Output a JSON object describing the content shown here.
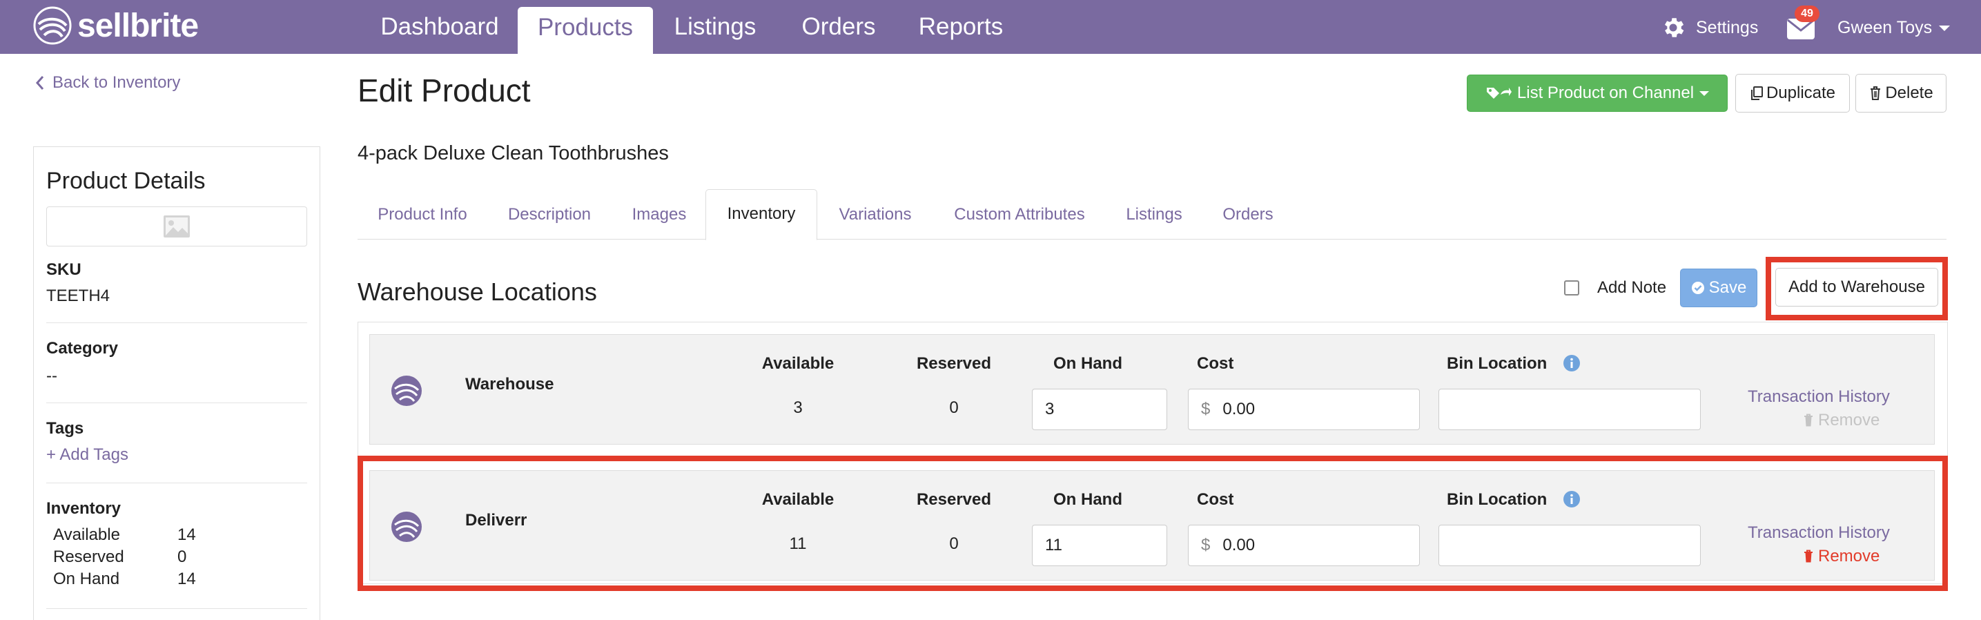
{
  "app": {
    "logo_text": "sellbrite"
  },
  "nav": {
    "items": [
      {
        "label": "Dashboard",
        "active": false
      },
      {
        "label": "Products",
        "active": true
      },
      {
        "label": "Listings",
        "active": false
      },
      {
        "label": "Orders",
        "active": false
      },
      {
        "label": "Reports",
        "active": false
      }
    ],
    "settings_label": "Settings",
    "mail_badge": "49",
    "account_label": "Gween Toys"
  },
  "sidebar": {
    "back_link": "Back to Inventory",
    "title": "Product Details",
    "sku_label": "SKU",
    "sku_value": "TEETH4",
    "category_label": "Category",
    "category_value": "--",
    "tags_label": "Tags",
    "add_tags": "+ Add Tags",
    "inventory_label": "Inventory",
    "inventory": [
      {
        "label": "Available",
        "value": "14"
      },
      {
        "label": "Reserved",
        "value": "0"
      },
      {
        "label": "On Hand",
        "value": "14"
      }
    ]
  },
  "header": {
    "title": "Edit Product",
    "product_name": "4-pack Deluxe Clean Toothbrushes",
    "list_button": "List Product on Channel",
    "duplicate_button": "Duplicate",
    "delete_button": "Delete"
  },
  "tabs": [
    {
      "label": "Product Info",
      "active": false
    },
    {
      "label": "Description",
      "active": false
    },
    {
      "label": "Images",
      "active": false
    },
    {
      "label": "Inventory",
      "active": true
    },
    {
      "label": "Variations",
      "active": false
    },
    {
      "label": "Custom Attributes",
      "active": false
    },
    {
      "label": "Listings",
      "active": false
    },
    {
      "label": "Orders",
      "active": false
    }
  ],
  "warehouse_section": {
    "title": "Warehouse Locations",
    "add_note_label": "Add Note",
    "save_button": "Save",
    "add_button": "Add to Warehouse",
    "columns": {
      "available": "Available",
      "reserved": "Reserved",
      "on_hand": "On Hand",
      "cost": "Cost",
      "bin_location": "Bin Location"
    },
    "currency_symbol": "$",
    "transaction_history_label": "Transaction History",
    "remove_label": "Remove",
    "warehouses": [
      {
        "name": "Warehouse",
        "available": "3",
        "reserved": "0",
        "on_hand": "3",
        "cost": "0.00",
        "bin_location": "",
        "remove_enabled": false
      },
      {
        "name": "Deliverr",
        "available": "11",
        "reserved": "0",
        "on_hand": "11",
        "cost": "0.00",
        "bin_location": "",
        "remove_enabled": true
      }
    ]
  },
  "colors": {
    "nav_bg": "#7a6aa0",
    "accent": "#7a6aa0",
    "success": "#5cb85c",
    "primary_light": "#7eaee6",
    "annotation_red": "#e23b2a",
    "danger": "#e23b2a"
  },
  "icons": {
    "logo": "sellbrite-swirl-icon",
    "settings": "gear-icon",
    "mail": "envelope-icon",
    "back": "chevron-left-icon",
    "image": "image-placeholder-icon",
    "list": "tags-share-icon",
    "duplicate": "copy-icon",
    "delete": "trash-icon",
    "save": "check-circle-icon",
    "info": "info-circle-icon",
    "remove": "trash-icon"
  }
}
